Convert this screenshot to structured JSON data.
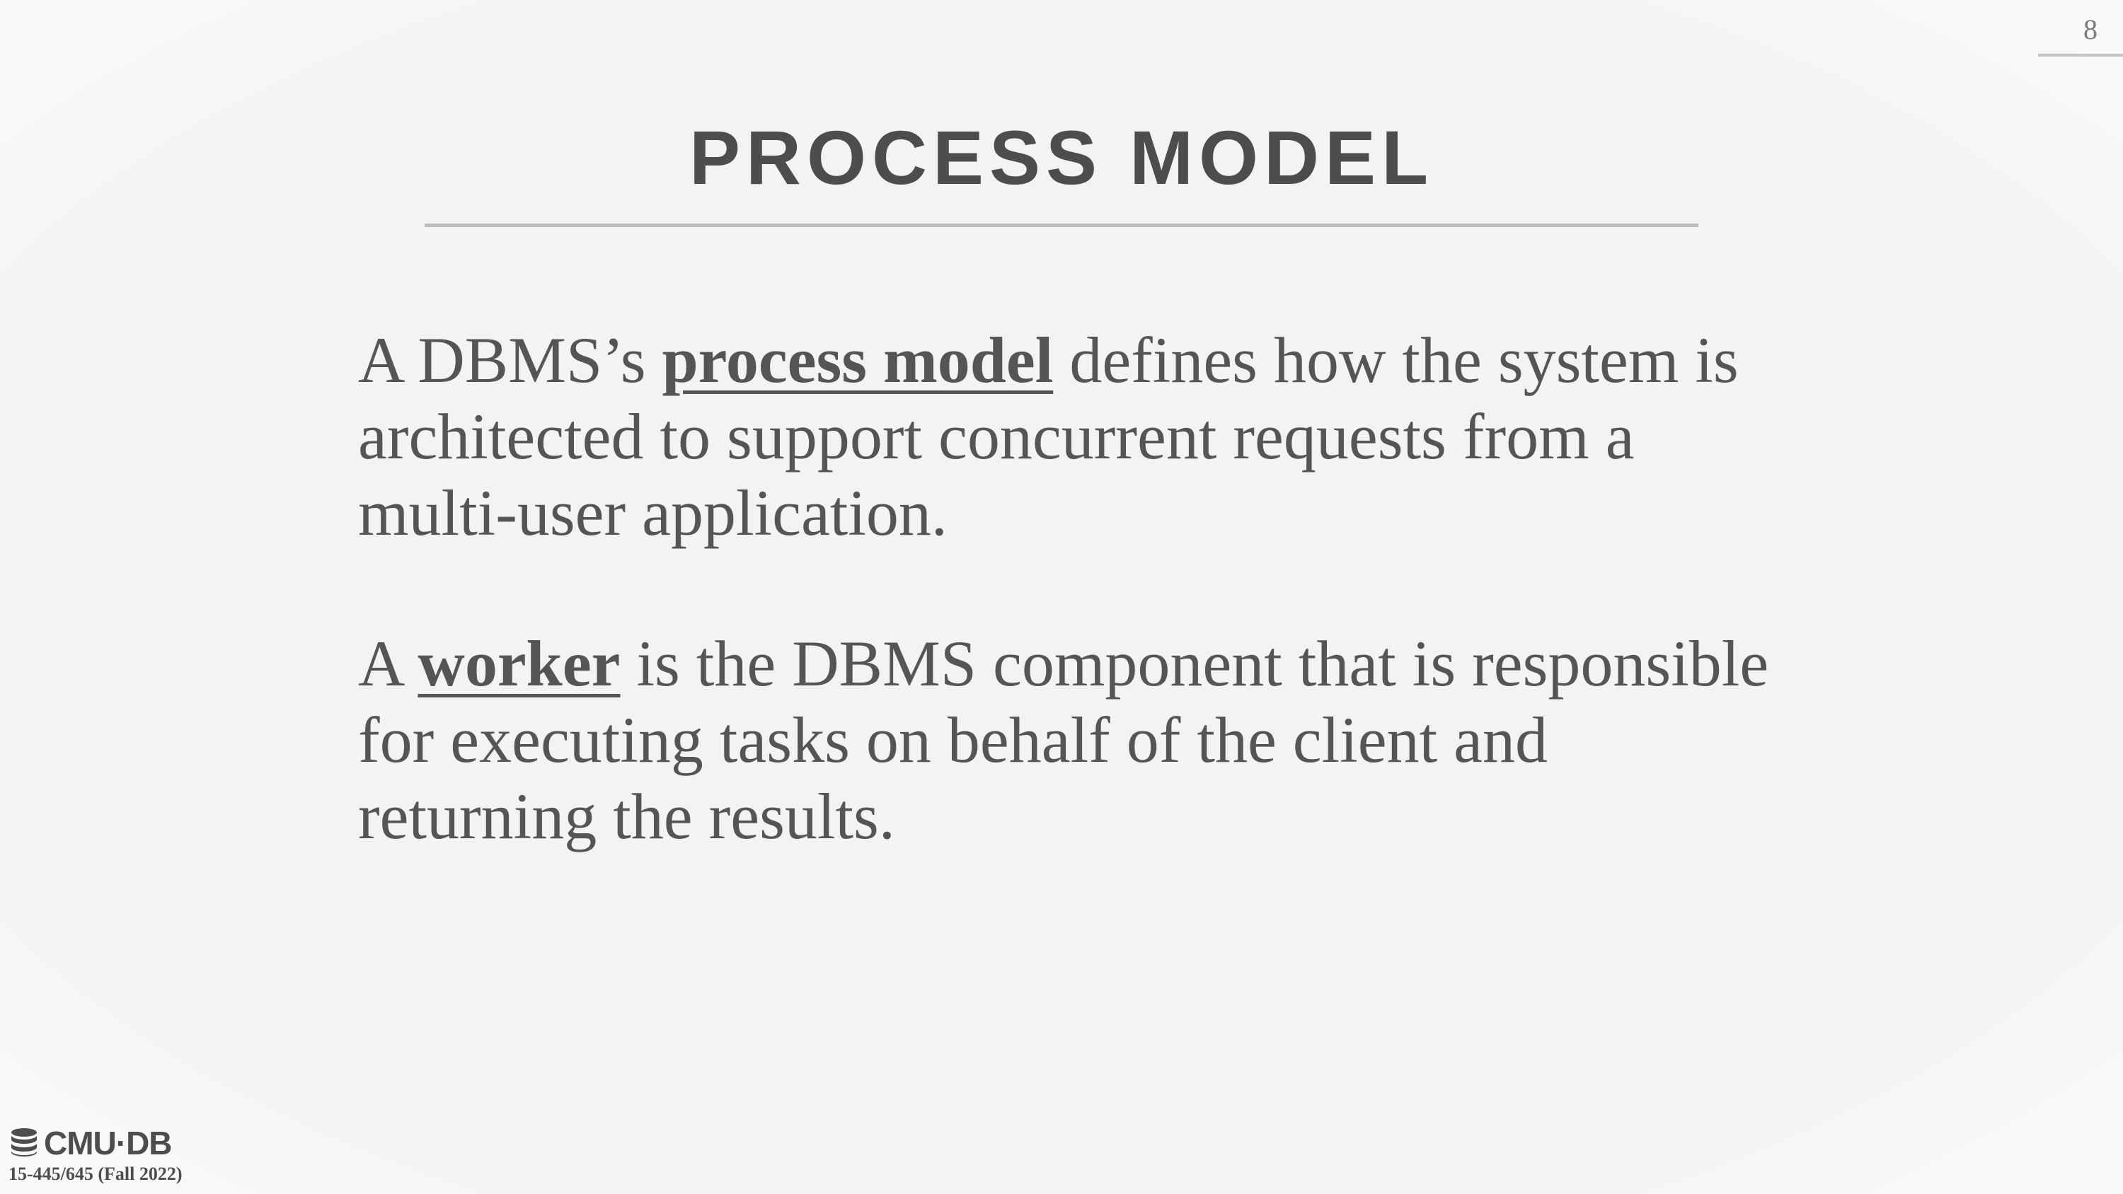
{
  "slide": {
    "page_number": "8",
    "title": "PROCESS MODEL",
    "paragraphs": [
      {
        "before": "A DBMS’s ",
        "term": "process model",
        "after": " defines how the system is architected to support concurrent requests from a multi-user application."
      },
      {
        "before": "A ",
        "term": "worker",
        "after": " is the DBMS component that is responsible for executing tasks on behalf of the client and returning the results."
      }
    ]
  },
  "footer": {
    "logo_text": "CMU·DB",
    "logo_icon": "database-icon",
    "course": "15-445/645 (Fall 2022)"
  },
  "colors": {
    "text": "#555555",
    "title": "#4d4d4d",
    "rule": "#bdbdbd",
    "background": "#f3f3f3"
  }
}
